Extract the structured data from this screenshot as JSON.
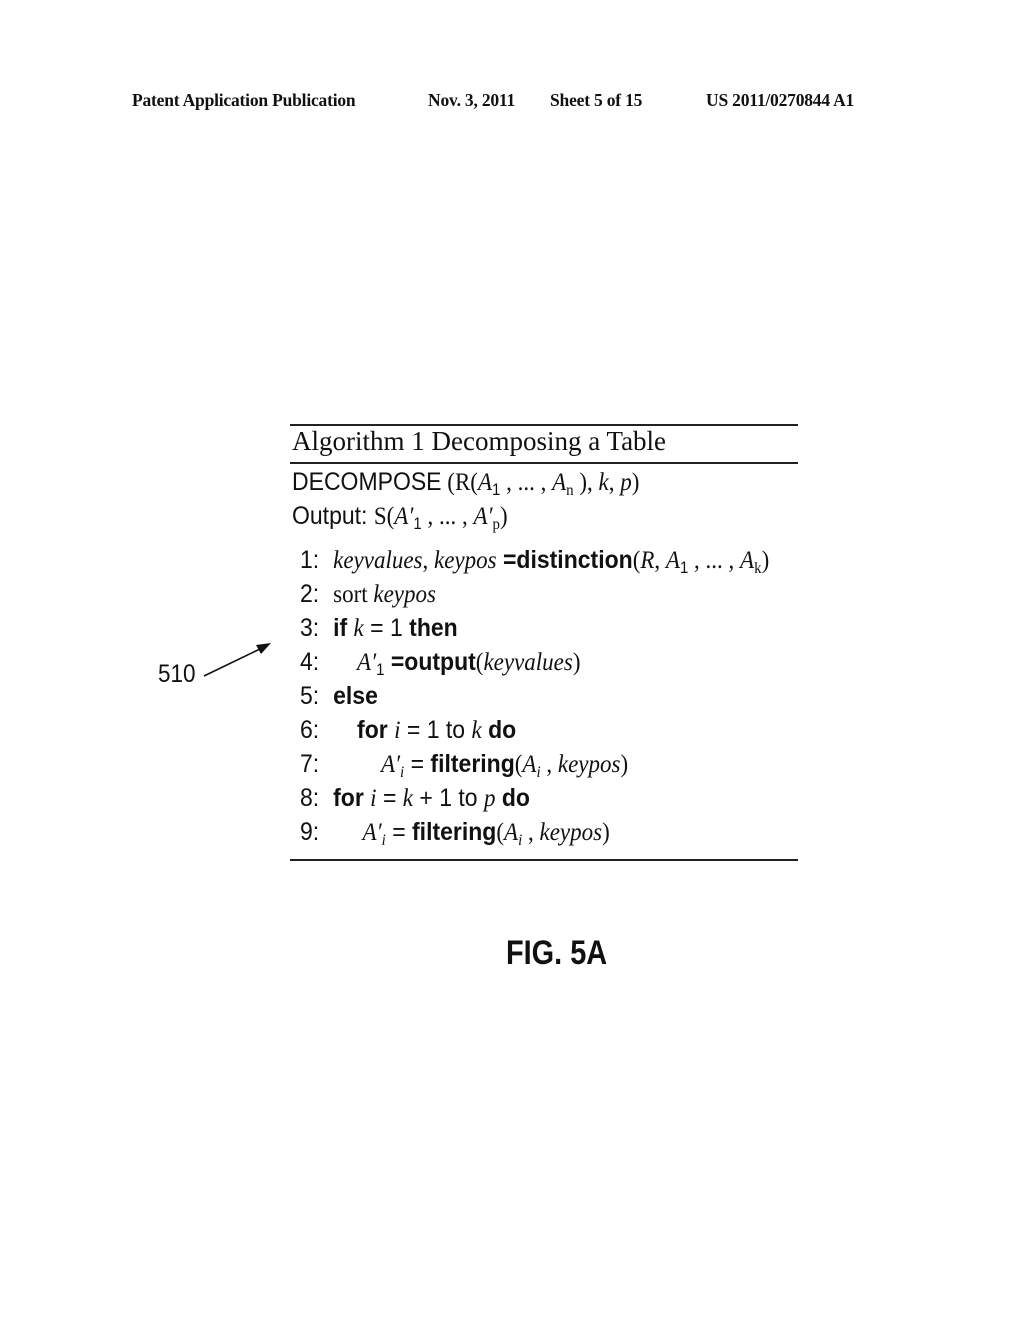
{
  "header": {
    "publication": "Patent Application Publication",
    "date": "Nov. 3, 2011",
    "sheet": "Sheet 5 of 15",
    "number": "US 2011/0270844 A1"
  },
  "algorithm": {
    "title": "Algorithm 1 Decomposing a Table",
    "signature": {
      "name": "DECOMPOSE",
      "open": " (R(",
      "a": "A",
      "sub1": "1",
      "sep": " , ... , ",
      "subn": "n",
      "close1": " ), ",
      "k": "k",
      "comma": ", ",
      "p": "p",
      "close2": ")"
    },
    "output": {
      "label": "Output: ",
      "s": "S(",
      "aprime": "A′",
      "sub1": "1",
      "sep": " , ... , ",
      "subp": "p",
      "close": ")"
    },
    "steps": [
      {
        "num": "1:",
        "keyvalues": "keyvalues",
        "comma": ", ",
        "keypos": "keypos",
        "eq": " =",
        "fn": "distinction",
        "open": "(",
        "r": "R",
        "rc": ", ",
        "a": "A",
        "sub1": "1",
        "sep": " , ... , ",
        "subk": "k",
        "close": ")"
      },
      {
        "num": "2:",
        "kw": "sort ",
        "keypos": "keypos"
      },
      {
        "num": "3:",
        "if": "if ",
        "k": "k",
        "eq": " = 1 ",
        "then": "then"
      },
      {
        "num": "4:",
        "aprime": "A′",
        "sub": "1",
        "eq": " =",
        "fn": "output",
        "open": "(",
        "arg": "keyvalues",
        "close": ")"
      },
      {
        "num": "5:",
        "kw": "else"
      },
      {
        "num": "6:",
        "for": "for ",
        "i": "i",
        "eq": " = 1 to ",
        "k": "k",
        "do": " do"
      },
      {
        "num": "7:",
        "aprime": "A′",
        "sub": "i",
        "eq": " = ",
        "fn": "filtering",
        "open": "(",
        "a": "A",
        "asub": "i",
        "comma": " , ",
        "keypos": "keypos",
        "close": ")"
      },
      {
        "num": "8:",
        "for": "for ",
        "i": "i",
        "eq": " = ",
        "k": "k",
        "plus": " + 1 to ",
        "p": "p",
        "do": " do"
      },
      {
        "num": "9:",
        "aprime": "A′",
        "sub": "i",
        "eq": " = ",
        "fn": "filtering",
        "open": "(",
        "a": "A",
        "asub": "i",
        "comma": " , ",
        "keypos": "keypos",
        "close": ")"
      }
    ]
  },
  "reference_label": "510",
  "figure_label": "FIG. 5A"
}
